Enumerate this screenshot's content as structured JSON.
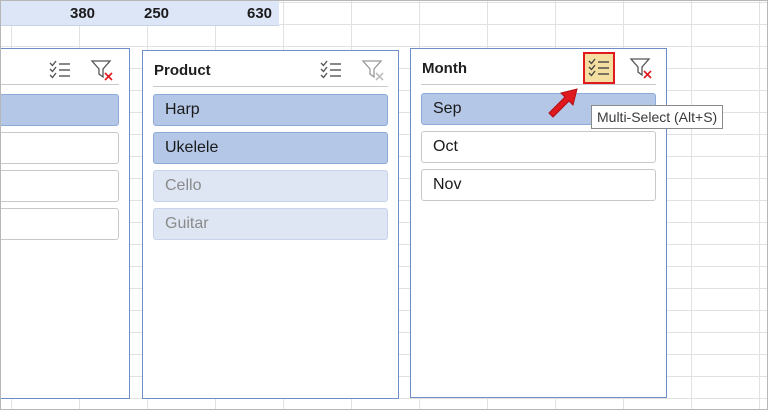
{
  "sheet": {
    "values": [
      "380",
      "250",
      "630"
    ]
  },
  "slicers": {
    "left": {
      "items": [
        "",
        "",
        "",
        ""
      ]
    },
    "product": {
      "title": "Product",
      "items": [
        {
          "label": "Harp",
          "state": "selected"
        },
        {
          "label": "Ukelele",
          "state": "selected"
        },
        {
          "label": "Cello",
          "state": "nodata"
        },
        {
          "label": "Guitar",
          "state": "nodata"
        }
      ]
    },
    "month": {
      "title": "Month",
      "items": [
        {
          "label": "Sep",
          "state": "selected"
        },
        {
          "label": "Oct",
          "state": "plain"
        },
        {
          "label": "Nov",
          "state": "plain"
        }
      ]
    }
  },
  "tooltip": "Multi-Select (Alt+S)",
  "colors": {
    "selected": "#b4c7e7",
    "nodata": "#dfe6f3",
    "highlight_border": "#e0191e",
    "arrow": "#e0191e",
    "slicer_border": "#6d8fc6"
  },
  "icons": [
    "multi-select-icon",
    "clear-filter-icon",
    "arrow-pointer-icon"
  ]
}
